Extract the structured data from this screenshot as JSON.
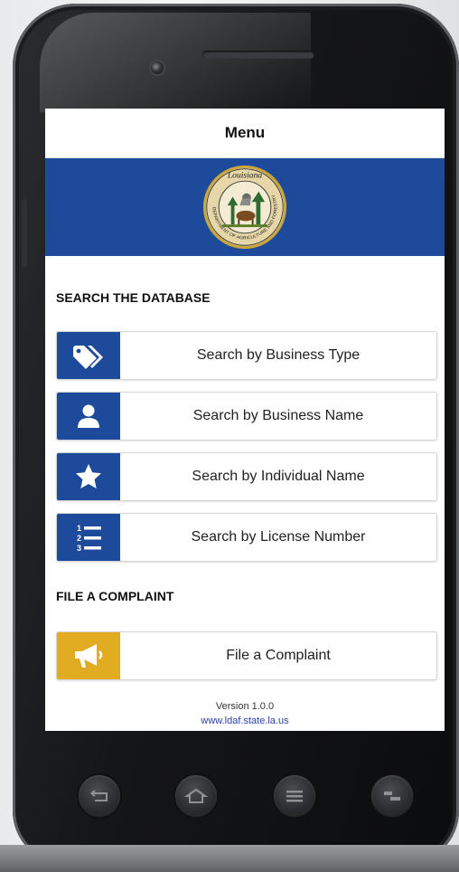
{
  "header": {
    "title": "Menu"
  },
  "banner": {
    "color": "#1d4a9a",
    "seal_text": "Louisiana",
    "seal_ring_text": "DEPARTMENT OF AGRICULTURE AND FORESTRY"
  },
  "search_section": {
    "heading": "SEARCH THE DATABASE",
    "items": [
      {
        "label": "Search by Business Type",
        "icon": "tag-icon"
      },
      {
        "label": "Search by Business Name",
        "icon": "person-icon"
      },
      {
        "label": "Search by Individual Name",
        "icon": "star-icon"
      },
      {
        "label": "Search by License Number",
        "icon": "numbered-list-icon"
      }
    ]
  },
  "complaint_section": {
    "heading": "FILE A COMPLAINT",
    "button_label": "File a Complaint",
    "icon": "megaphone-icon"
  },
  "footer": {
    "version": "Version 1.0.0",
    "link": "www.ldaf.state.la.us"
  },
  "colors": {
    "primary_blue": "#1d4a9a",
    "complaint_gold": "#e2ac22",
    "link": "#2b3ea8"
  },
  "device_nav": [
    "back-icon",
    "home-icon",
    "menu-icon",
    "recent-apps-icon"
  ]
}
